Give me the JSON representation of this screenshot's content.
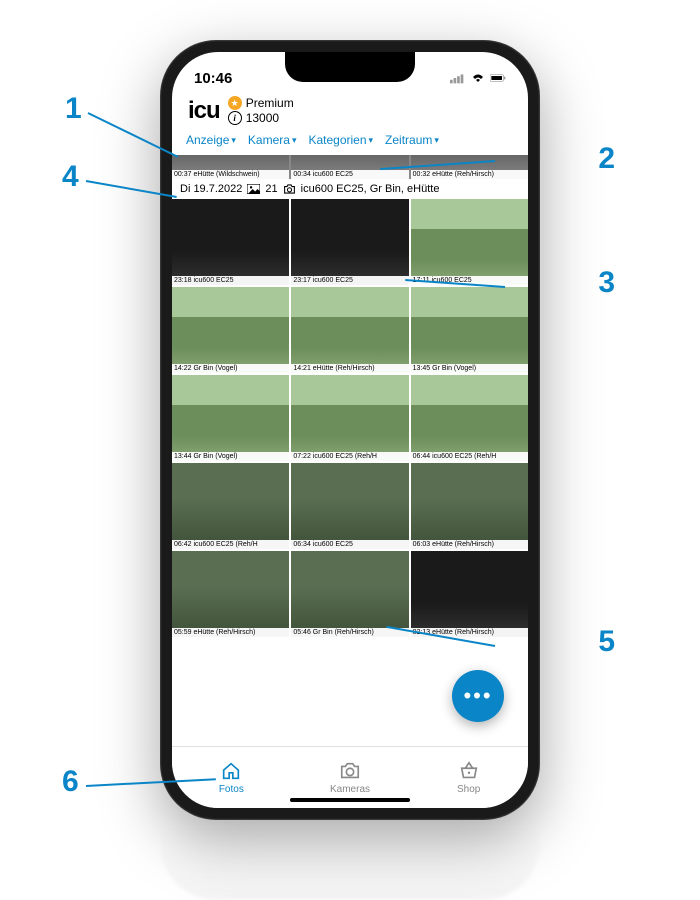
{
  "status_bar": {
    "time": "10:46"
  },
  "header": {
    "logo": "icu",
    "tier_label": "Premium",
    "credits": "13000"
  },
  "filters": [
    {
      "label": "Anzeige"
    },
    {
      "label": "Kamera"
    },
    {
      "label": "Kategorien"
    },
    {
      "label": "Zeitraum"
    }
  ],
  "strip": [
    {
      "label": "00:37 eHütte  (Wildschwein)"
    },
    {
      "label": "00:34 icu600 EC25"
    },
    {
      "label": "00:32 eHütte  (Reh/Hirsch)"
    }
  ],
  "date_header": {
    "date": "Di 19.7.2022",
    "count": "21",
    "cameras": "icu600 EC25, Gr Bin, eHütte"
  },
  "grid": [
    [
      {
        "label": "23:18 icu600 EC25",
        "variant": "night"
      },
      {
        "label": "23:17 icu600 EC25",
        "variant": "night"
      },
      {
        "label": "17:11 icu600 EC25",
        "variant": "day"
      }
    ],
    [
      {
        "label": "14:22 Gr Bin  (Vogel)",
        "variant": "day"
      },
      {
        "label": "14:21 eHütte  (Reh/Hirsch)",
        "variant": "day"
      },
      {
        "label": "13:45 Gr Bin  (Vogel)",
        "variant": "day"
      }
    ],
    [
      {
        "label": "13:44 Gr Bin  (Vogel)",
        "variant": "day"
      },
      {
        "label": "07:22 icu600 EC25  (Reh/H",
        "variant": "day"
      },
      {
        "label": "06:44 icu600 EC25  (Reh/H",
        "variant": "day"
      }
    ],
    [
      {
        "label": "06:42 icu600 EC25  (Reh/H",
        "variant": "dusk"
      },
      {
        "label": "06:34 icu600 EC25",
        "variant": "dusk"
      },
      {
        "label": "06:03 eHütte  (Reh/Hirsch)",
        "variant": "dusk"
      }
    ],
    [
      {
        "label": "05:59 eHütte  (Reh/Hirsch)",
        "variant": "dusk"
      },
      {
        "label": "05:46 Gr Bin  (Reh/Hirsch)",
        "variant": "dusk"
      },
      {
        "label": "02:13 eHütte  (Reh/Hirsch)",
        "variant": "night"
      }
    ]
  ],
  "fab": {
    "label": "•••"
  },
  "tabs": [
    {
      "label": "Fotos",
      "active": true
    },
    {
      "label": "Kameras",
      "active": false
    },
    {
      "label": "Shop",
      "active": false
    }
  ],
  "callouts": {
    "c1": "1",
    "c2": "2",
    "c3": "3",
    "c4": "4",
    "c5": "5",
    "c6": "6"
  }
}
